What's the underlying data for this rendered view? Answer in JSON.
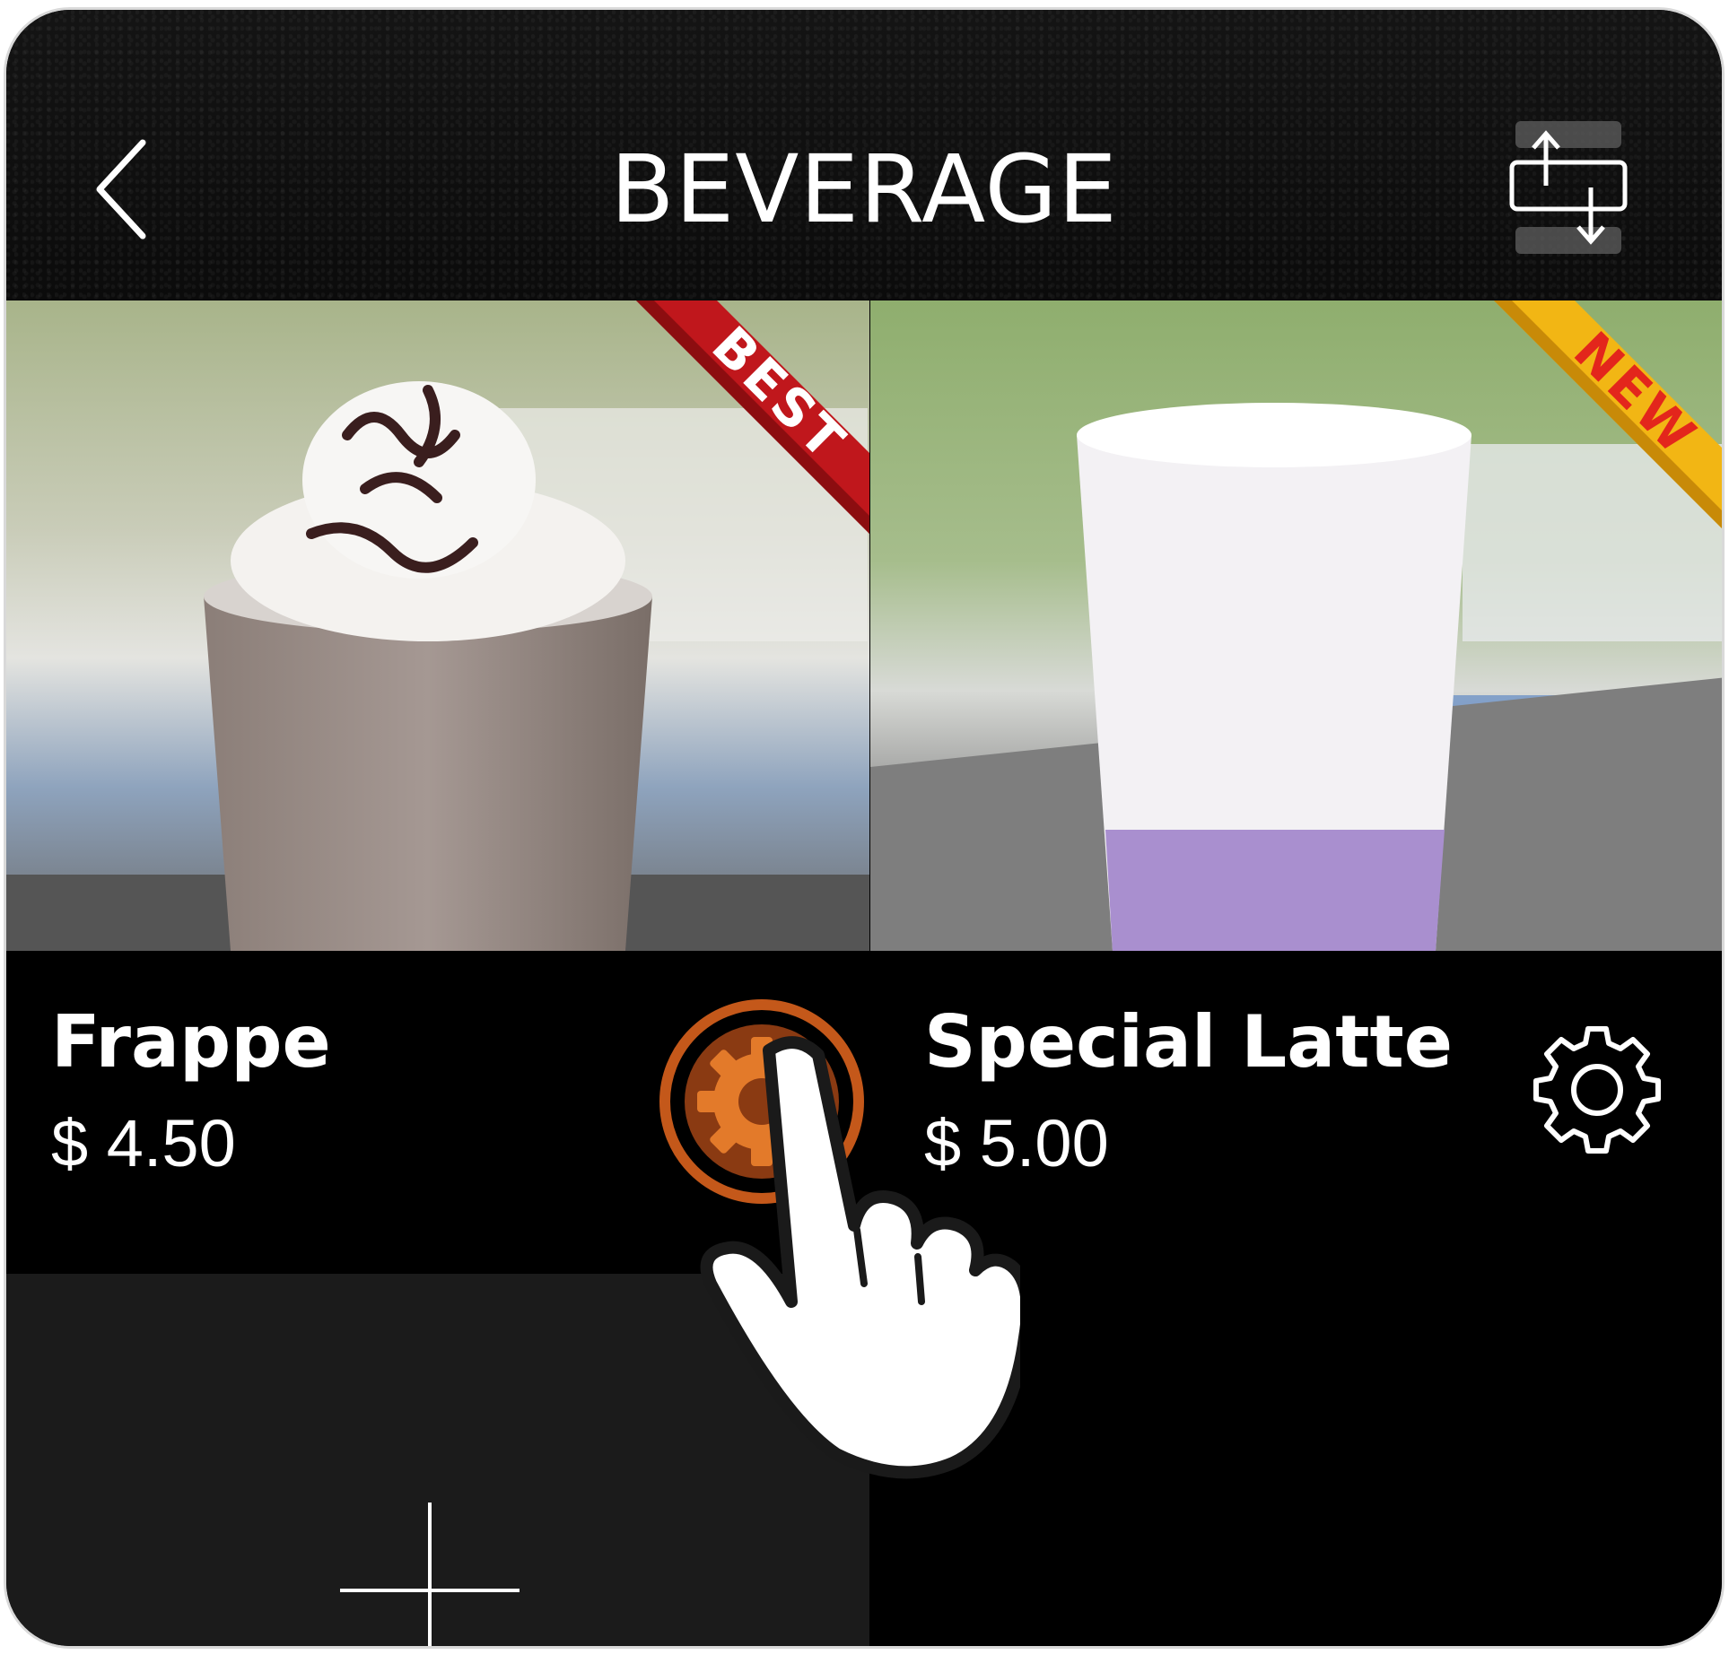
{
  "header": {
    "title": "BEVERAGE",
    "back_icon": "chevron-left-icon",
    "swap_icon": "swap-vertical-icon"
  },
  "products": [
    {
      "name": "Frappe",
      "price": "$ 4.50",
      "badge": "BEST",
      "badge_color": "#c0171c",
      "settings_icon": "gear-icon",
      "settings_state": "tapped",
      "highlight_color": "#c4581a"
    },
    {
      "name": "Special Latte",
      "price": "$ 5.00",
      "badge": "NEW",
      "badge_color": "#f2b614",
      "settings_icon": "gear-icon"
    }
  ],
  "add_slot": {
    "icon": "plus-icon"
  },
  "overlay": {
    "icon": "hand-pointer-icon"
  }
}
